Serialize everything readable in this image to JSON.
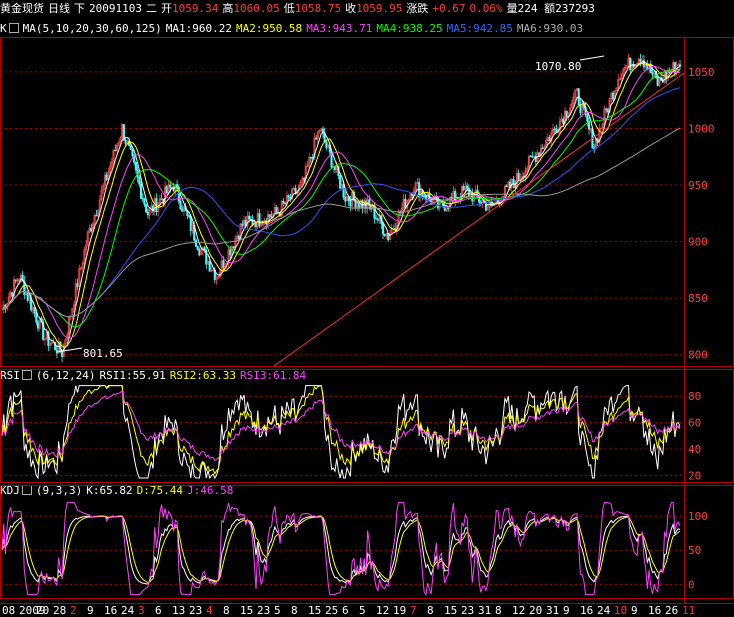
{
  "header": {
    "title": "黄金现货",
    "period": "日线",
    "direction": "下",
    "date": "20091103",
    "weekday": "二",
    "open_label": "开",
    "open": "1059.34",
    "high_label": "高",
    "high": "1060.05",
    "low_label": "低",
    "low": "1058.75",
    "close_label": "收",
    "close": "1059.95",
    "change_label": "涨跌",
    "change": "+0.67",
    "change_pct": "0.06%",
    "volume": "量224",
    "amount": "额237293"
  },
  "ma_bar": {
    "prefix": "K",
    "name": "MA",
    "params": "(5,10,20,30,60,125)",
    "ma1": "MA1:960.22",
    "ma2": "MA2:950.58",
    "ma3": "MA3:943.71",
    "ma4": "MA4:938.25",
    "ma5": "MA5:942.85",
    "ma6": "MA6:930.03"
  },
  "rsi_bar": {
    "name": "RSI",
    "params": "(6,12,24)",
    "rsi1": "RSI1:55.91",
    "rsi2": "RSI2:63.33",
    "rsi3": "RSI3:61.84"
  },
  "kdj_bar": {
    "name": "KDJ",
    "params": "(9,3,3)",
    "k": "K:65.82",
    "d": "D:75.44",
    "j": "J:46.58"
  },
  "annotations": {
    "high_mark": "1070.80",
    "low_mark": "801.65"
  },
  "price_axis": [
    "1050",
    "1000",
    "950",
    "900",
    "850",
    "800"
  ],
  "rsi_axis": [
    "80",
    "60",
    "40",
    "20"
  ],
  "kdj_axis": [
    "100",
    "50",
    "0"
  ],
  "date_axis": [
    "08",
    "2009",
    "20",
    "28",
    "2",
    "9",
    "16",
    "24",
    "3",
    "6",
    "13",
    "23",
    "4",
    "8",
    "15",
    "23",
    "5",
    "8",
    "15",
    "25",
    "6",
    "5",
    "12",
    "19",
    "7",
    "8",
    "15",
    "23",
    "31",
    "8",
    "12",
    "20",
    "31",
    "9",
    "16",
    "24",
    "10",
    "9",
    "16",
    "26",
    "11"
  ],
  "colors": {
    "up": "#ff4848",
    "down": "#40ffff",
    "grid": "#b00000",
    "axis_text": "#ff4040",
    "ma1": "#ffffff",
    "ma2": "#ffff00",
    "ma3": "#ff40ff",
    "ma4": "#00ff00",
    "ma5": "#3050ff",
    "ma6": "#999999"
  }
}
